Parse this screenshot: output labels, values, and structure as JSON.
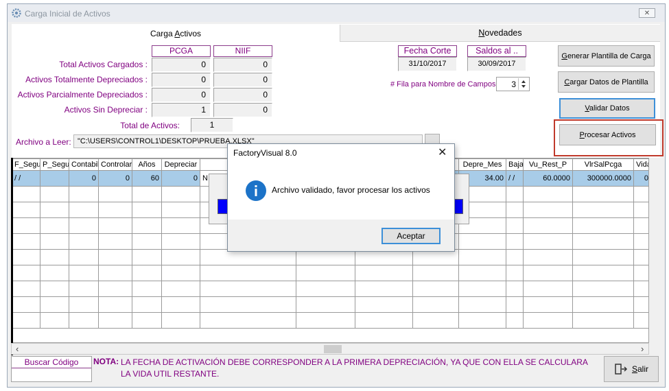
{
  "window": {
    "title": "Carga Inicial de Activos"
  },
  "tabs": [
    {
      "label": "Carga Activos"
    },
    {
      "label": "Novedades"
    }
  ],
  "summary": {
    "col_pcga": "PCGA",
    "col_niif": "NIIF",
    "rows": [
      {
        "label": "Total Activos Cargados :",
        "pcga": "0",
        "niif": "0"
      },
      {
        "label": "Activos Totalmente Depreciados :",
        "pcga": "0",
        "niif": "0"
      },
      {
        "label": "Activos Parcialmente Depreciados :",
        "pcga": "0",
        "niif": "0"
      },
      {
        "label": "Activos Sin Depreciar :",
        "pcga": "1",
        "niif": "0"
      }
    ],
    "total_label": "Total de Activos:",
    "total_value": "1"
  },
  "dates": {
    "fecha_corte_label": "Fecha Corte",
    "fecha_corte_value": "31/10/2017",
    "saldos_label": "Saldos al ..",
    "saldos_value": "30/09/2017"
  },
  "fila": {
    "label": "# Fila para Nombre de Campos",
    "value": "3"
  },
  "file": {
    "label": "Archivo a Leer:",
    "path": "\"C:\\USERS\\CONTROL1\\DESKTOP\\PRUEBA.XLSX\""
  },
  "buttons": {
    "generar": "Generar Plantilla de Carga",
    "cargar": "Cargar Datos de Plantilla",
    "validar": "Validar Datos",
    "procesar": "Procesar Activos",
    "salir": "Salir"
  },
  "grid": {
    "left_headers": [
      "F_Segu",
      "P_Segu",
      "Contabil",
      "Controlar",
      "Años",
      "Depreciar"
    ],
    "right_headers": [
      "Depre_Mes",
      "Baja",
      "Vu_Rest_P",
      "VlrSalPcga",
      "Vida"
    ],
    "left_row": [
      "/ /",
      "",
      "0",
      "0",
      "60",
      "0"
    ],
    "partial_cell": "N",
    "right_row": [
      "34.00",
      "/ /",
      "60.0000",
      "300000.0000",
      "0"
    ]
  },
  "search": {
    "label": "Buscar Código"
  },
  "note": {
    "label": "NOTA:",
    "text": "LA FECHA DE ACTIVACIÓN DEBE CORRESPONDER A LA PRIMERA DEPRECIACIÓN, YA QUE CON ELLA SE CALCULARA LA VIDA UTIL RESTANTE."
  },
  "dialog": {
    "title": "FactoryVisual 8.0",
    "message": "Archivo validado, favor procesar los activos",
    "ok": "Aceptar"
  },
  "colors": {
    "label_purple": "#800080",
    "selection": "#a8cce8",
    "highlight_red": "#c0392b",
    "info_blue": "#1c73c8"
  }
}
